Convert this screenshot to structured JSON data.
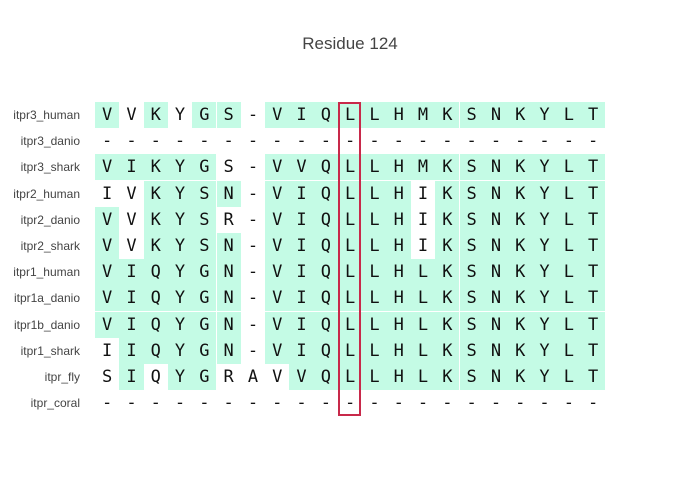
{
  "title": "Residue 124",
  "colors": {
    "conserved": "#c4fbe5",
    "highlight_box": "#c8294a",
    "text": "#444444"
  },
  "highlighted_column_index": 10,
  "sequences": [
    {
      "name": "itpr3_human",
      "residues": "VVKYGS-VIQLLHMKSNKYLT",
      "hl": "101011011111111111111"
    },
    {
      "name": "itpr3_danio",
      "residues": "---------------------",
      "hl": "000000000000000000000"
    },
    {
      "name": "itpr3_shark",
      "residues": "VIKYGS-VVQLLHMKSNKYLT",
      "hl": "111110011111111111111"
    },
    {
      "name": "itpr2_human",
      "residues": "IVKYSN-VIQLLHIKSNKYLT",
      "hl": "001111011111101111111"
    },
    {
      "name": "itpr2_danio",
      "residues": "VVKYSR-VIQLLHIKSNKYLT",
      "hl": "101110011111101111111"
    },
    {
      "name": "itpr2_shark",
      "residues": "VVKYSN-VIQLLHIKSNKYLT",
      "hl": "101111011111101111111"
    },
    {
      "name": "itpr1_human",
      "residues": "VIQYGN-VIQLLHLKSNKYLT",
      "hl": "111111011111111111111"
    },
    {
      "name": "itpr1a_danio",
      "residues": "VIQYGN-VIQLLHLKSNKYLT",
      "hl": "111111011111111111111"
    },
    {
      "name": "itpr1b_danio",
      "residues": "VIQYGN-VIQLLHLKSNKYLT",
      "hl": "111111011111111111111"
    },
    {
      "name": "itpr1_shark",
      "residues": "IIQYGN-VIQLLHLKSNKYLT",
      "hl": "011111011111111111111"
    },
    {
      "name": "itpr_fly",
      "residues": "SIQYGRAVVQLLHLKSNKYLT",
      "hl": "010110001111111111111"
    },
    {
      "name": "itpr_coral",
      "residues": "---------------------",
      "hl": "000000000000000000000"
    }
  ]
}
